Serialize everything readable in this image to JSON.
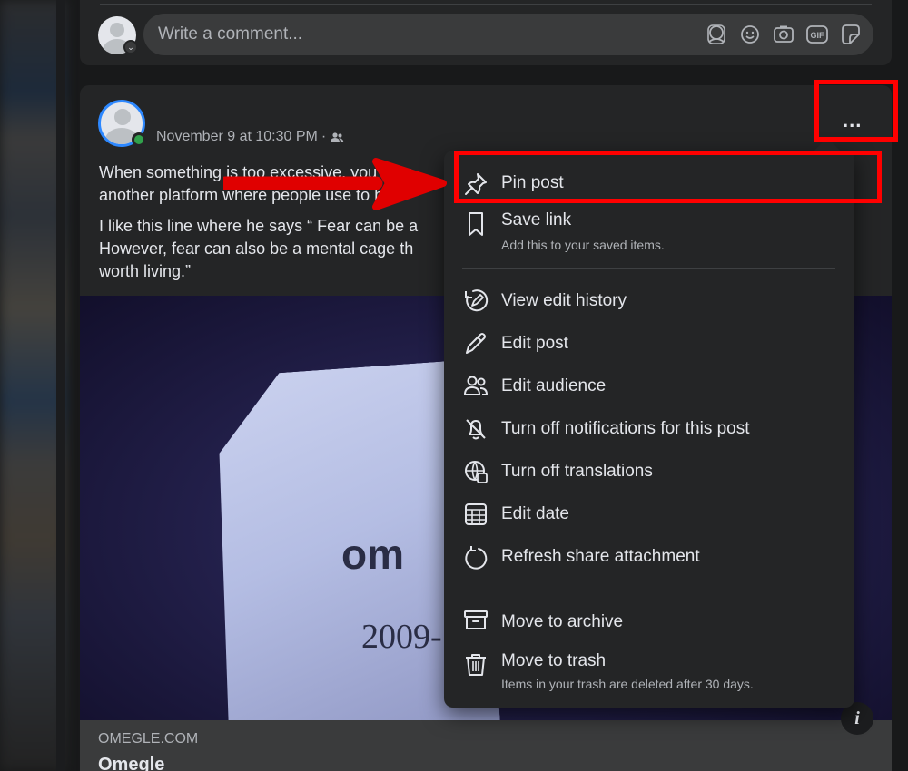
{
  "comment_bar": {
    "placeholder": "Write a comment...",
    "icons": [
      "avatar-sticker-icon",
      "emoji-icon",
      "camera-icon",
      "gif-icon",
      "sticker-icon"
    ]
  },
  "post": {
    "date": "November 9 at 10:30 PM",
    "separator": "·",
    "audience_icon": "friends-icon",
    "more_label": "...",
    "text_lines": [
      "When something is too excessive, you do n",
      "another platform where people use to be",
      "I like this line where he says “ Fear can be a",
      "However, fear can also be a mental cage th",
      "worth living.”"
    ],
    "media": {
      "shirt_logo": "om",
      "shirt_year": "2009-"
    },
    "link_preview": {
      "domain": "OMEGLE.COM",
      "title": "Omegle"
    },
    "info_label": "i"
  },
  "menu": {
    "items": [
      {
        "label": "Pin post",
        "icon": "pin-icon"
      },
      {
        "label": "Save link",
        "sub": "Add this to your saved items.",
        "icon": "bookmark-icon"
      },
      {
        "label": "View edit history",
        "icon": "edit-history-icon"
      },
      {
        "label": "Edit post",
        "icon": "pencil-icon"
      },
      {
        "label": "Edit audience",
        "icon": "audience-icon"
      },
      {
        "label": "Turn off notifications for this post",
        "icon": "bell-off-icon"
      },
      {
        "label": "Turn off translations",
        "icon": "globe-translate-icon"
      },
      {
        "label": "Edit date",
        "icon": "calendar-icon"
      },
      {
        "label": "Refresh share attachment",
        "icon": "refresh-icon"
      },
      {
        "label": "Move to archive",
        "icon": "archive-icon"
      },
      {
        "label": "Move to trash",
        "sub": "Items in your trash are deleted after 30 days.",
        "icon": "trash-icon"
      }
    ]
  },
  "annotations": {
    "highlight_color": "#ff0000",
    "targets": [
      "more-options-button",
      "pin-post-menu-item"
    ]
  },
  "colors": {
    "background": "#18191a",
    "card": "#242526",
    "input": "#3a3b3c",
    "text_primary": "#e4e6eb",
    "text_secondary": "#b0b3b8",
    "online": "#31a24c",
    "avatar_ring": "#2d88ff"
  }
}
